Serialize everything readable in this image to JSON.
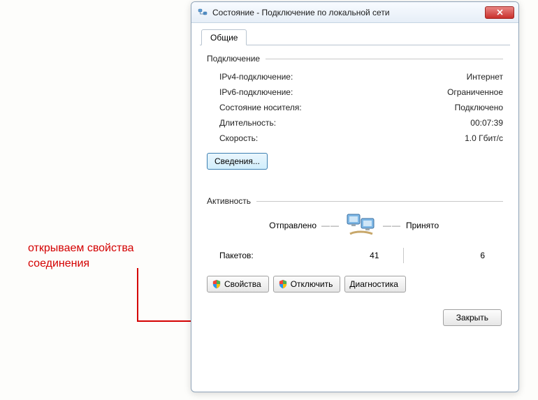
{
  "annotation": {
    "line1": "открываем свойства",
    "line2": "соединения"
  },
  "window": {
    "title": "Состояние - Подключение по локальной сети"
  },
  "tabs": {
    "general": "Общие"
  },
  "connection": {
    "header": "Подключение",
    "rows": {
      "ipv4": {
        "label": "IPv4-подключение:",
        "value": "Интернет"
      },
      "ipv6": {
        "label": "IPv6-подключение:",
        "value": "Ограниченное"
      },
      "media": {
        "label": "Состояние носителя:",
        "value": "Подключено"
      },
      "duration": {
        "label": "Длительность:",
        "value": "00:07:39"
      },
      "speed": {
        "label": "Скорость:",
        "value": "1.0 Гбит/с"
      }
    },
    "details_btn": "Сведения..."
  },
  "activity": {
    "header": "Активность",
    "sent_label": "Отправлено",
    "received_label": "Принято",
    "packets_label": "Пакетов:",
    "sent_packets": "41",
    "received_packets": "6"
  },
  "buttons": {
    "properties": "Свойства",
    "disable": "Отключить",
    "diagnose": "Диагностика",
    "close": "Закрыть"
  }
}
